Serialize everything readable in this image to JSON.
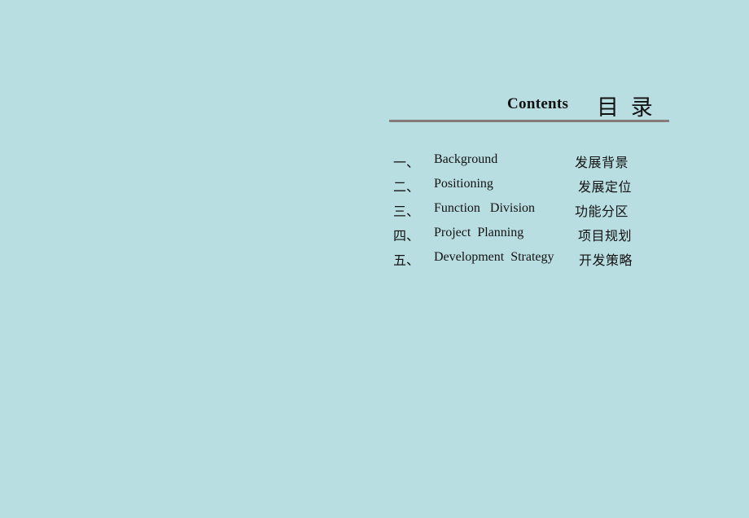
{
  "slide": {
    "background_color": "#b9dee2",
    "text_color": "#121212",
    "divider_color": "#857b78"
  },
  "heading": {
    "english_title": "Contents",
    "chinese_title": "目 录"
  },
  "contents": {
    "items": [
      {
        "index": "一、",
        "english": "Background",
        "chinese": "发展背景"
      },
      {
        "index": "二、",
        "english": "Positioning",
        "chinese": "发展定位"
      },
      {
        "index": "三、",
        "english": "Function   Division",
        "chinese": "功能分区"
      },
      {
        "index": "四、",
        "english": "Project  Planning",
        "chinese": "项目规划"
      },
      {
        "index": "五、",
        "english": "Development  Strategy",
        "chinese": "开发策略"
      }
    ]
  }
}
